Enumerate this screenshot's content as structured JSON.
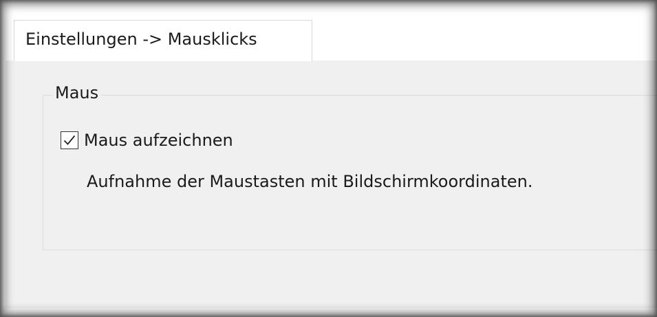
{
  "tabs": [
    {
      "label": "Einstellungen -> Mausklicks",
      "active": true
    }
  ],
  "group": {
    "title": "Maus",
    "checkbox": {
      "label": "Maus aufzeichnen",
      "checked": true
    },
    "description": "Aufnahme der Maustasten mit Bildschirmkoordinaten."
  },
  "colors": {
    "panel_background": "#f0f0f0",
    "tab_background": "#ffffff",
    "border": "#d9d9d9",
    "text": "#1a1a1a"
  },
  "icons": {
    "checkbox": "checkmark-icon"
  }
}
